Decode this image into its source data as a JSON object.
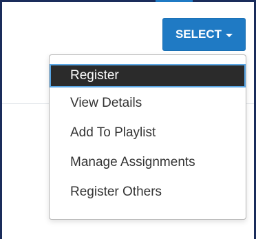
{
  "select_button": {
    "label": "SELECT"
  },
  "menu": {
    "items": [
      {
        "label": "Register",
        "active": true
      },
      {
        "label": "View Details",
        "active": false
      },
      {
        "label": "Add To Playlist",
        "active": false
      },
      {
        "label": "Manage Assignments",
        "active": false
      },
      {
        "label": "Register Others",
        "active": false
      }
    ]
  },
  "colors": {
    "accent": "#1f7ac4",
    "frame": "#1a2c5b",
    "active_bg": "#2b2b2b",
    "focus_ring": "#5aa7e6"
  }
}
